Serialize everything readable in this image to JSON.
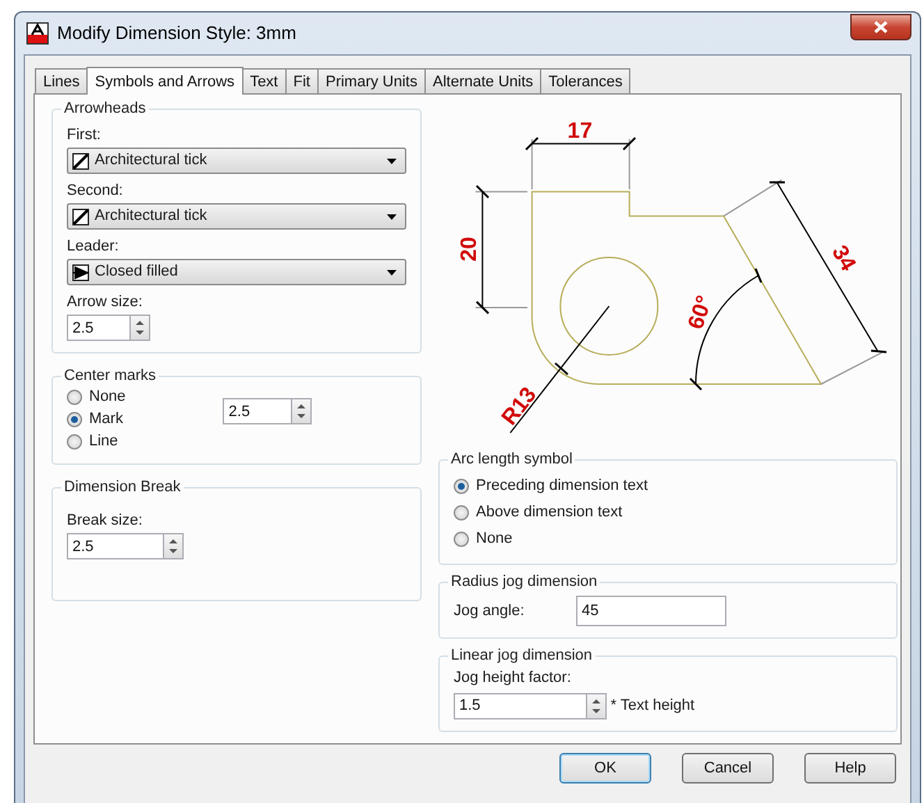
{
  "window": {
    "title": "Modify Dimension Style: 3mm"
  },
  "tabs": [
    {
      "label": "Lines",
      "selected": false
    },
    {
      "label": "Symbols and Arrows",
      "selected": true
    },
    {
      "label": "Text",
      "selected": false
    },
    {
      "label": "Fit",
      "selected": false
    },
    {
      "label": "Primary Units",
      "selected": false
    },
    {
      "label": "Alternate Units",
      "selected": false
    },
    {
      "label": "Tolerances",
      "selected": false
    }
  ],
  "arrowheads": {
    "title": "Arrowheads",
    "fields": [
      {
        "label": "First:",
        "value": "Architectural tick",
        "kind": "tick"
      },
      {
        "label": "Second:",
        "value": "Architectural tick",
        "kind": "tick"
      },
      {
        "label": "Leader:",
        "value": "Closed filled",
        "kind": "filled"
      }
    ],
    "arrow_size": {
      "label": "Arrow size:",
      "value": "2.5"
    }
  },
  "center_marks": {
    "title": "Center marks",
    "options": [
      {
        "label": "None",
        "selected": false
      },
      {
        "label": "Mark",
        "selected": true
      },
      {
        "label": "Line",
        "selected": false
      }
    ],
    "size": "2.5"
  },
  "dimension_break": {
    "title": "Dimension Break",
    "label": "Break size:",
    "value": "2.5"
  },
  "preview": {
    "labels": [
      "17",
      "20",
      "34",
      "60°",
      "R13"
    ]
  },
  "arc_length_symbol": {
    "title": "Arc length symbol",
    "options": [
      {
        "label": "Preceding dimension text",
        "selected": true
      },
      {
        "label": "Above dimension text",
        "selected": false
      },
      {
        "label": "None",
        "selected": false
      }
    ]
  },
  "radius_jog": {
    "title": "Radius jog dimension",
    "label": "Jog angle:",
    "value": "45"
  },
  "linear_jog": {
    "title": "Linear jog dimension",
    "label": "Jog height factor:",
    "value": "1.5",
    "suffix": "* Text height"
  },
  "buttons": [
    {
      "label": "OK",
      "default": true
    },
    {
      "label": "Cancel",
      "default": false
    },
    {
      "label": "Help",
      "default": false
    }
  ]
}
